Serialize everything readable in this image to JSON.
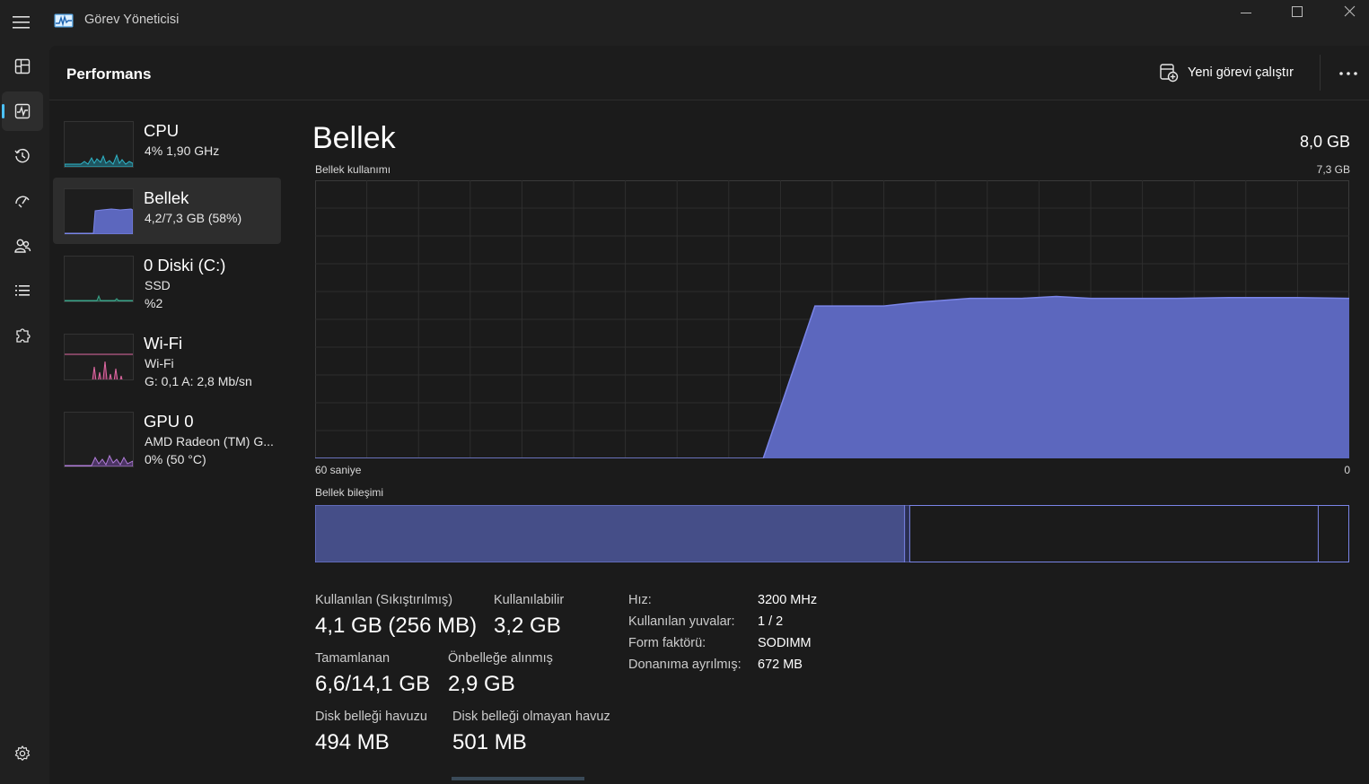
{
  "window": {
    "title": "Görev Yöneticisi"
  },
  "nav": {
    "items": [
      {
        "name": "processes",
        "icon": "processes-icon"
      },
      {
        "name": "performance",
        "icon": "performance-icon",
        "active": true
      },
      {
        "name": "app-history",
        "icon": "history-icon"
      },
      {
        "name": "startup-apps",
        "icon": "startup-gauge-icon"
      },
      {
        "name": "users",
        "icon": "users-icon"
      },
      {
        "name": "details",
        "icon": "details-list-icon"
      },
      {
        "name": "services",
        "icon": "services-puzzle-icon"
      }
    ],
    "settings_icon": "gear-icon"
  },
  "header": {
    "title": "Performans",
    "run_task_label": "Yeni görevi çalıştır",
    "more_icon": "more-dots-icon"
  },
  "sidebar": {
    "items": [
      {
        "name": "CPU",
        "sub1": "4%  1,90 GHz",
        "sub2": "",
        "color": "#2fb5c8"
      },
      {
        "name": "Bellek",
        "sub1": "4,2/7,3 GB (58%)",
        "sub2": "",
        "color": "#6b74d4",
        "selected": true
      },
      {
        "name": "0 Diski (C:)",
        "sub1": "SSD",
        "sub2": "%2",
        "color": "#3aa58a"
      },
      {
        "name": "Wi-Fi",
        "sub1": "Wi-Fi",
        "sub2": "G: 0,1  A: 2,8 Mb/sn",
        "color": "#e26aa4"
      },
      {
        "name": "GPU 0",
        "sub1": "AMD Radeon (TM) G...",
        "sub2": "0%  (50 °C)",
        "color": "#b07cd8"
      }
    ]
  },
  "detail": {
    "title": "Bellek",
    "total": "8,0 GB",
    "usage_label": "Bellek kullanımı",
    "usage_max": "7,3 GB",
    "time_left": "60 saniye",
    "time_right": "0",
    "composition_label": "Bellek bileşimi",
    "colors": {
      "fill": "#5c67be",
      "line": "#7a85e8",
      "grid": "#2e2e2e",
      "composition_used": "#454e88"
    }
  },
  "stats": {
    "in_use_label": "Kullanılan (Sıkıştırılmış)",
    "in_use_value": "4,1 GB (256 MB)",
    "available_label": "Kullanılabilir",
    "available_value": "3,2 GB",
    "committed_label": "Tamamlanan",
    "committed_value": "6,6/14,1 GB",
    "cached_label": "Önbelleğe alınmış",
    "cached_value": "2,9 GB",
    "paged_pool_label": "Disk belleği havuzu",
    "paged_pool_value": "494 MB",
    "nonpaged_pool_label": "Disk belleği olmayan havuz",
    "nonpaged_pool_value": "501 MB"
  },
  "hardware": {
    "speed_label": "Hız:",
    "speed_value": "3200 MHz",
    "slots_label": "Kullanılan yuvalar:",
    "slots_value": "1 / 2",
    "form_label": "Form faktörü:",
    "form_value": "SODIMM",
    "reserved_label": "Donanıma ayrılmış:",
    "reserved_value": "672 MB"
  },
  "chart_data": {
    "type": "area",
    "title": "Bellek kullanımı",
    "xlabel": "",
    "ylabel": "",
    "x_labels": [
      "60 saniye",
      "0"
    ],
    "xlim": [
      60,
      0
    ],
    "ylim": [
      0,
      7.3
    ],
    "y_unit": "GB",
    "grid": true,
    "series": [
      {
        "x": [
          60,
          35,
          34,
          31,
          27,
          25,
          22,
          19,
          17,
          15,
          10,
          7,
          3,
          0
        ],
        "values": [
          0,
          0,
          0,
          4.0,
          4.0,
          4.1,
          4.2,
          4.2,
          4.25,
          4.2,
          4.2,
          4.22,
          4.22,
          4.2
        ]
      }
    ],
    "composition": {
      "in_use_fraction": 0.57,
      "modified_fraction": 0.005,
      "standby_fraction": 0.395,
      "free_fraction": 0.03
    }
  }
}
